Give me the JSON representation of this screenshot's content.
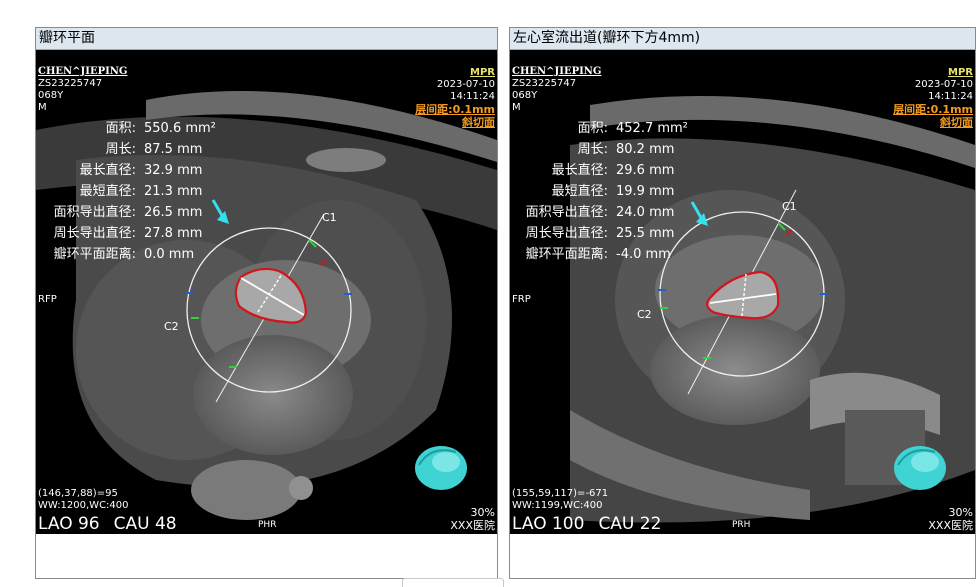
{
  "panels": [
    {
      "title": "瓣环平面",
      "patient": {
        "name": "CHEN^JIEPING",
        "id": "ZS23225747",
        "age": "068Y",
        "sex": "M"
      },
      "top_right": {
        "mode": "MPR",
        "date": "2023-07-10",
        "time": "14:11:24",
        "spacing": "层间距:0.1mm",
        "plane": "斜切面"
      },
      "measurements": [
        {
          "label": "面积:",
          "value": "550.6 mm²"
        },
        {
          "label": "周长:",
          "value": "87.5 mm"
        },
        {
          "label": "最长直径:",
          "value": "32.9 mm"
        },
        {
          "label": "最短直径:",
          "value": "21.3 mm"
        },
        {
          "label": "面积导出直径:",
          "value": "26.5 mm"
        },
        {
          "label": "周长导出直径:",
          "value": "27.8 mm"
        },
        {
          "label": "瓣环平面距离:",
          "value": "0.0 mm"
        }
      ],
      "side_label": "RFP",
      "c1": "C1",
      "c2": "C2",
      "pixel_info": "(146,37,88)=95",
      "window": "WW:1200,WC:400",
      "view_angle_1": "LAO 96",
      "view_angle_2": "CAU 48",
      "orientation": "PHR",
      "zoom": "30%",
      "hospital": "XXX医院"
    },
    {
      "title": "左心室流出道(瓣环下方4mm)",
      "patient": {
        "name": "CHEN^JIEPING",
        "id": "ZS23225747",
        "age": "068Y",
        "sex": "M"
      },
      "top_right": {
        "mode": "MPR",
        "date": "2023-07-10",
        "time": "14:11:24",
        "spacing": "层间距:0.1mm",
        "plane": "斜切面"
      },
      "measurements": [
        {
          "label": "面积:",
          "value": "452.7 mm²"
        },
        {
          "label": "周长:",
          "value": "80.2 mm"
        },
        {
          "label": "最长直径:",
          "value": "29.6 mm"
        },
        {
          "label": "最短直径:",
          "value": "19.9 mm"
        },
        {
          "label": "面积导出直径:",
          "value": "24.0 mm"
        },
        {
          "label": "周长导出直径:",
          "value": "25.5 mm"
        },
        {
          "label": "瓣环平面距离:",
          "value": "-4.0 mm"
        }
      ],
      "side_label": "FRP",
      "c1": "C1",
      "c2": "C2",
      "pixel_info": "(155,59,117)=-671",
      "window": "WW:1199,WC:400",
      "view_angle_1": "LAO 100",
      "view_angle_2": "CAU 22",
      "orientation": "PRH",
      "zoom": "30%",
      "hospital": "XXX医院"
    }
  ],
  "colors": {
    "header_bg": "#dde7ef",
    "annulus_outline": "#d2141b",
    "pointer_arrow": "#35e0ee",
    "mpr_label": "#e8e36c",
    "spacing_label": "#f39c1f",
    "model_3d": "#3fd3d3"
  }
}
